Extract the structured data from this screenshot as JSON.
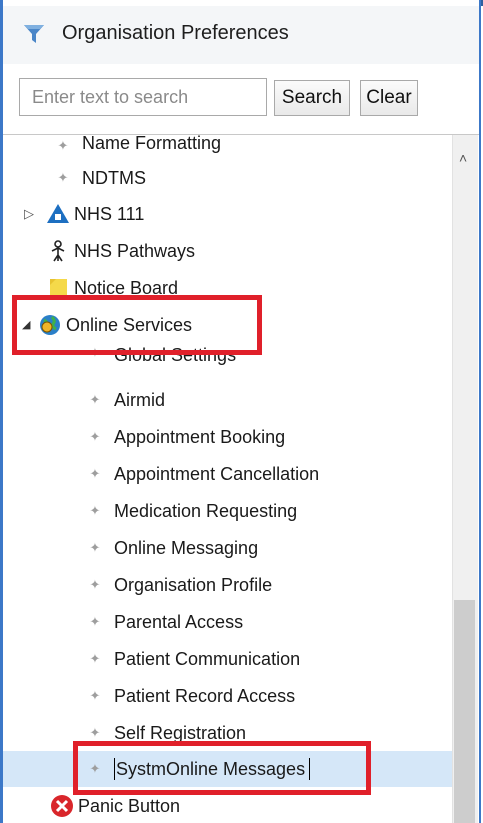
{
  "window": {
    "title": "Organisation Preferences"
  },
  "search": {
    "placeholder": "Enter text to search",
    "value": "",
    "search_label": "Search",
    "clear_label": "Clear"
  },
  "tree": {
    "name_formatting": "Name Formatting",
    "ndtms": "NDTMS",
    "nhs111": "NHS 111",
    "nhs_pathways": "NHS Pathways",
    "notice_board": "Notice Board",
    "online_services": "Online Services",
    "children": [
      "Global Settings",
      "Airmid",
      "Appointment Booking",
      "Appointment Cancellation",
      "Medication Requesting",
      "Online Messaging",
      "Organisation Profile",
      "Parental Access",
      "Patient Communication",
      "Patient Record Access",
      "Self Registration",
      "SystmOnline Messages"
    ],
    "panic_button": "Panic Button"
  },
  "colors": {
    "highlight": "#e0202a",
    "selection": "#d5e7f8",
    "accent": "#3c78c8"
  },
  "icons": {
    "title": "funnel-icon",
    "nhs111": "nhs-triangle-icon",
    "nhs_pathways": "person-arrow-icon",
    "notice_board": "sticky-note-icon",
    "online_services": "globe-icon",
    "panic_button": "red-x-circle-icon"
  }
}
